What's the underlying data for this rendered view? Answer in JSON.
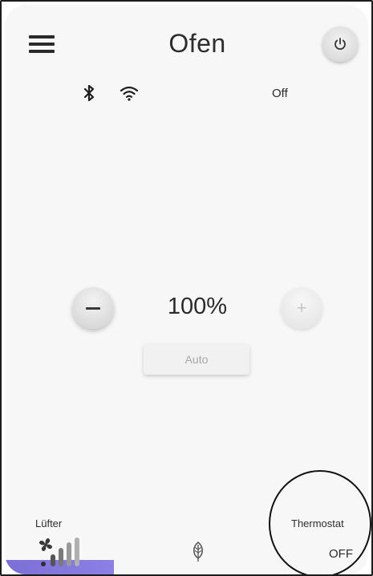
{
  "header": {
    "title": "Ofen",
    "menu_icon": "hamburger-menu-icon",
    "power_icon": "power-icon"
  },
  "status": {
    "bluetooth_icon": "bluetooth-icon",
    "wifi_icon": "wifi-icon",
    "state": "Off"
  },
  "control": {
    "level": "100%",
    "minus_label": "−",
    "plus_label": "+",
    "auto_label": "Auto"
  },
  "footer": {
    "fan_label": "Lüfter",
    "fan_icon": "fan-level-icon",
    "eco_icon": "leaf-icon",
    "thermostat_label": "Thermostat",
    "thermostat_value": "OFF"
  },
  "colors": {
    "accent": "#7b6fd6",
    "background": "#f7f7f7",
    "text": "#2b2b2b",
    "disabled": "#a8a8a8"
  }
}
